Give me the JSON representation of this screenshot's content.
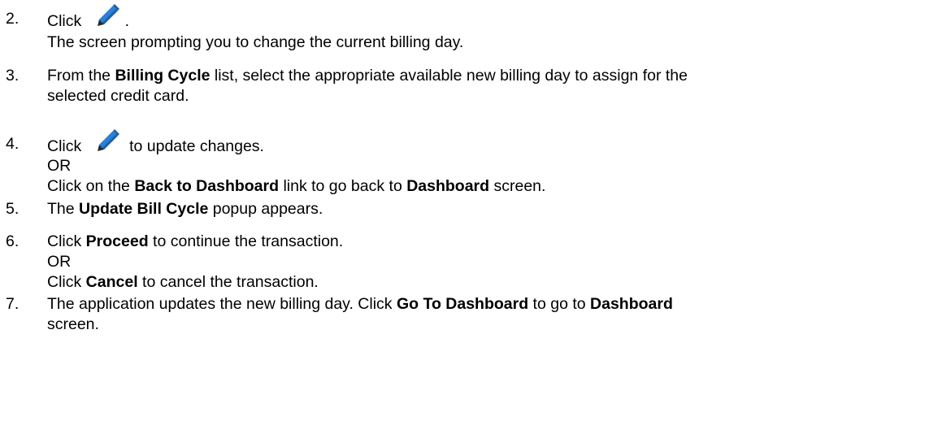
{
  "steps": [
    {
      "number": "2.",
      "lines": [
        {
          "parts": [
            {
              "t": "Click "
            },
            {
              "icon": "pencil-edit-icon"
            },
            {
              "t": "."
            }
          ]
        },
        {
          "parts": [
            {
              "t": "The screen prompting you to change the current billing day."
            }
          ]
        }
      ]
    },
    {
      "number": "3.",
      "lines": [
        {
          "parts": [
            {
              "t": "From the "
            },
            {
              "b": "Billing Cycle"
            },
            {
              "t": " list, select the appropriate available new billing day to assign for the"
            }
          ]
        },
        {
          "parts": [
            {
              "t": "selected credit card."
            }
          ]
        }
      ]
    },
    {
      "number": "4.",
      "lines": [
        {
          "parts": [
            {
              "t": "Click "
            },
            {
              "icon": "pencil-edit-icon"
            },
            {
              "t": " to update changes."
            }
          ]
        },
        {
          "parts": [
            {
              "t": "OR"
            }
          ]
        },
        {
          "parts": [
            {
              "t": "Click on the "
            },
            {
              "b": "Back to Dashboard"
            },
            {
              "t": " link to go back to "
            },
            {
              "b": "Dashboard"
            },
            {
              "t": " screen."
            }
          ]
        }
      ]
    },
    {
      "number": "5.",
      "lines": [
        {
          "parts": [
            {
              "t": "The "
            },
            {
              "b": "Update Bill Cycle"
            },
            {
              "t": " popup appears."
            }
          ]
        }
      ]
    },
    {
      "number": "6.",
      "lines": [
        {
          "parts": [
            {
              "t": "Click "
            },
            {
              "b": "Proceed"
            },
            {
              "t": " to continue the transaction."
            }
          ]
        },
        {
          "parts": [
            {
              "t": "OR"
            }
          ]
        },
        {
          "parts": [
            {
              "t": "Click "
            },
            {
              "b": "Cancel"
            },
            {
              "t": " to cancel the transaction."
            }
          ]
        }
      ]
    },
    {
      "number": "7.",
      "lines": [
        {
          "parts": [
            {
              "t": "The application updates the new billing day. Click "
            },
            {
              "b": "Go To Dashboard"
            },
            {
              "t": " to go to "
            },
            {
              "b": "Dashboard"
            }
          ]
        },
        {
          "parts": [
            {
              "t": "screen."
            }
          ]
        }
      ]
    }
  ],
  "colors": {
    "text": "#000000",
    "icon_blue": "#2b7fd4",
    "icon_dark": "#1a5fa8",
    "icon_tip": "#2a2a2a"
  }
}
